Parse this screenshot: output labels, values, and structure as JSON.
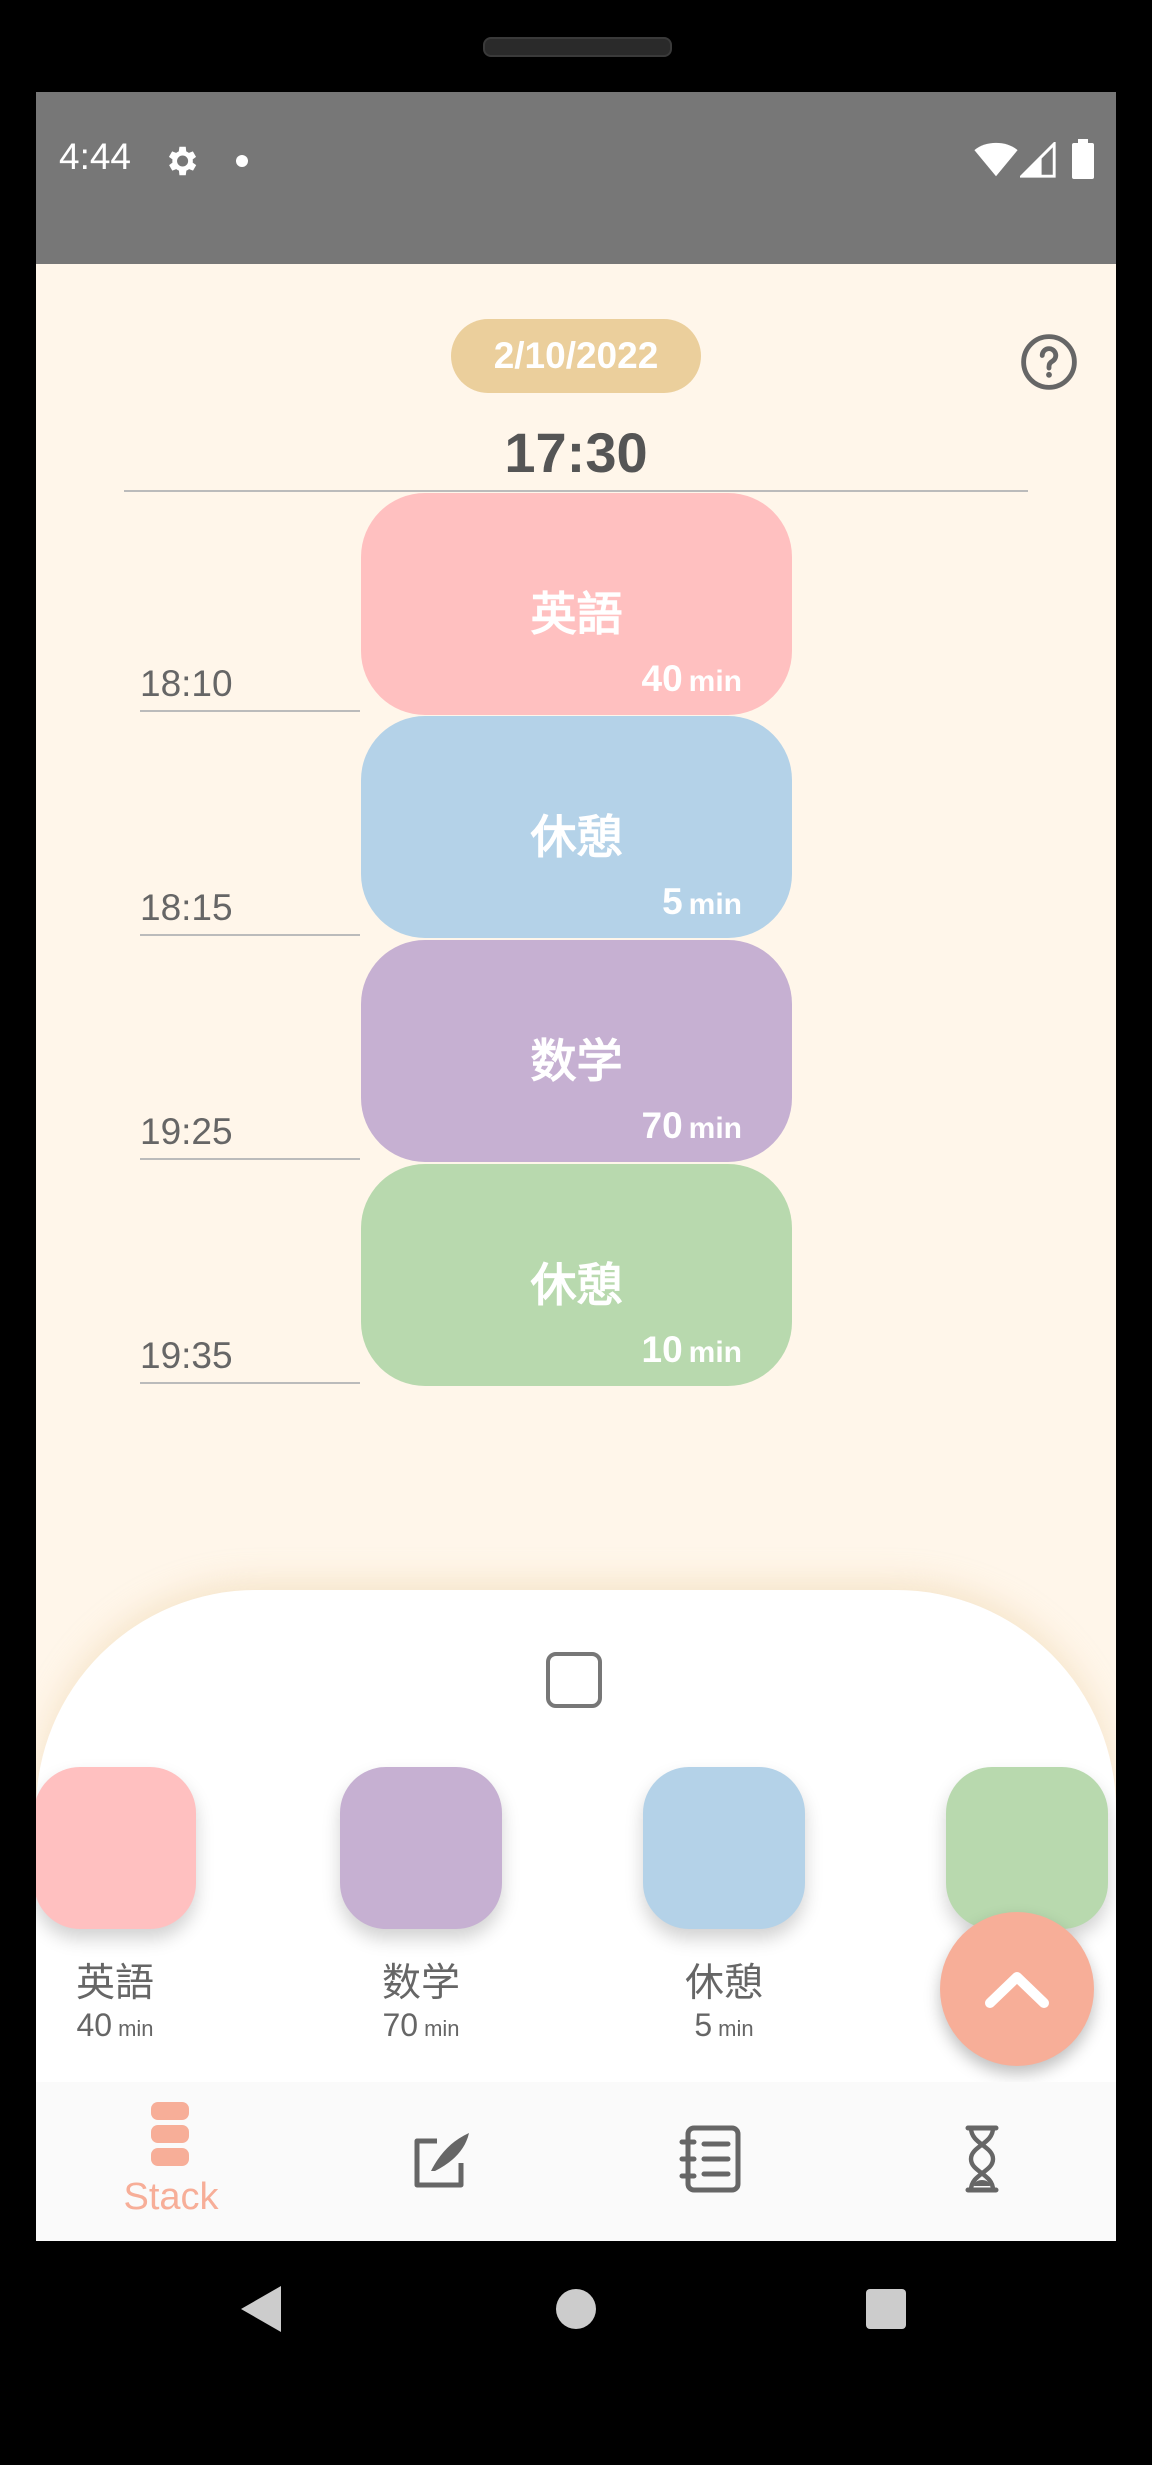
{
  "status_bar": {
    "time": "4:44"
  },
  "header": {
    "date": "2/10/2022",
    "start_time": "17:30"
  },
  "timeline": {
    "blocks": [
      {
        "name": "英語",
        "duration": "40",
        "unit": "min",
        "end_time": "18:10",
        "color": "#ffc0c0"
      },
      {
        "name": "休憩",
        "duration": "5",
        "unit": "min",
        "end_time": "18:15",
        "color": "#b4d2e8"
      },
      {
        "name": "数学",
        "duration": "70",
        "unit": "min",
        "end_time": "19:25",
        "color": "#c6b0d2"
      },
      {
        "name": "休憩",
        "duration": "10",
        "unit": "min",
        "end_time": "19:35",
        "color": "#b8d9ae"
      }
    ]
  },
  "palette": {
    "items": [
      {
        "name": "英語",
        "duration": "40",
        "unit": "min",
        "color": "#ffc0c0"
      },
      {
        "name": "数学",
        "duration": "70",
        "unit": "min",
        "color": "#c6b0d2"
      },
      {
        "name": "休憩",
        "duration": "5",
        "unit": "min",
        "color": "#b4d2e8"
      },
      {
        "name": "",
        "duration": "",
        "unit": "",
        "color": "#b8d9ae"
      }
    ]
  },
  "nav": {
    "items": [
      {
        "label": "Stack",
        "icon": "stack-icon",
        "active": true
      },
      {
        "label": "",
        "icon": "edit-icon",
        "active": false
      },
      {
        "label": "",
        "icon": "notebook-icon",
        "active": false
      },
      {
        "label": "",
        "icon": "hourglass-icon",
        "active": false
      }
    ]
  },
  "colors": {
    "accent": "#f7ae98",
    "background": "#fff6ea",
    "date_pill": "#ebcf9c"
  }
}
